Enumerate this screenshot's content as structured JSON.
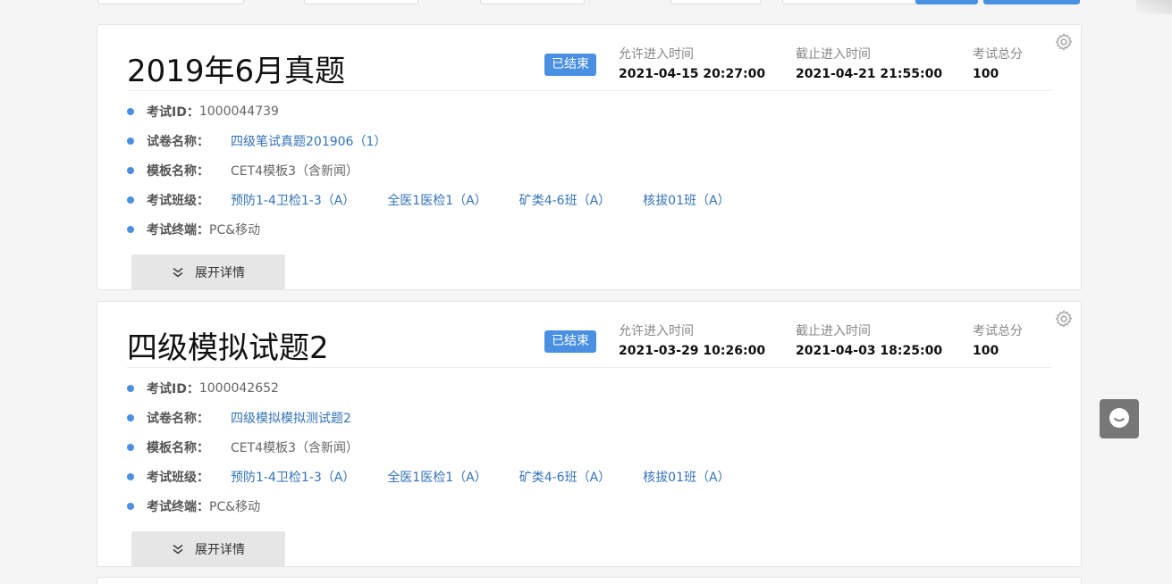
{
  "exams": [
    {
      "title": "2019年6月真题",
      "status": "已结束",
      "start_label": "允许进入时间",
      "start_value": "2021-04-15 20:27:00",
      "end_label": "截止进入时间",
      "end_value": "2021-04-21 21:55:00",
      "score_label": "考试总分",
      "score_value": "100",
      "exam_id_label": "考试ID：",
      "exam_id": "1000044739",
      "paper_label": "试卷名称：",
      "paper_name": "四级笔试真题201906（1）",
      "template_label": "模板名称：",
      "template_name": "CET4模板3（含新闻）",
      "classes_label": "考试班级：",
      "classes": [
        "预防1-4卫检1-3（A）",
        "全医1医检1（A）",
        "矿类4-6班（A）",
        "核拔01班（A）"
      ],
      "terminal_label": "考试终端：",
      "terminal": "PC&移动",
      "expand_label": "展开详情"
    },
    {
      "title": "四级模拟试题2",
      "status": "已结束",
      "start_label": "允许进入时间",
      "start_value": "2021-03-29 10:26:00",
      "end_label": "截止进入时间",
      "end_value": "2021-04-03 18:25:00",
      "score_label": "考试总分",
      "score_value": "100",
      "exam_id_label": "考试ID：",
      "exam_id": "1000042652",
      "paper_label": "试卷名称：",
      "paper_name": "四级模拟模拟测试题2",
      "template_label": "模板名称：",
      "template_name": "CET4模板3（含新闻）",
      "classes_label": "考试班级：",
      "classes": [
        "预防1-4卫检1-3（A）",
        "全医1医检1（A）",
        "矿类4-6班（A）",
        "核拔01班（A）"
      ],
      "terminal_label": "考试终端：",
      "terminal": "PC&移动",
      "expand_label": "展开详情"
    }
  ],
  "colors": {
    "accent": "#4a90e2",
    "link": "#3473b9",
    "expand_bg": "#e6e6e6"
  },
  "icons": {
    "settings": "gear-icon",
    "expand": "double-chevron-down-icon",
    "chat": "chat-bubble-icon"
  }
}
